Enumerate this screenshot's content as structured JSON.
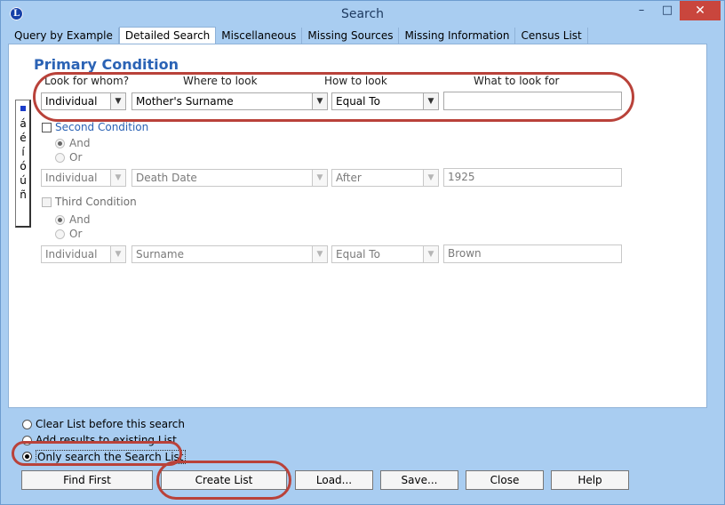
{
  "window": {
    "title": "Search",
    "app_icon_letter": "L",
    "min_glyph": "–",
    "max_glyph": "□",
    "close_glyph": "✕"
  },
  "tabs": [
    {
      "label": "Query by Example"
    },
    {
      "label": "Detailed Search"
    },
    {
      "label": "Miscellaneous"
    },
    {
      "label": "Missing Sources"
    },
    {
      "label": "Missing Information"
    },
    {
      "label": "Census List"
    }
  ],
  "primary": {
    "title": "Primary Condition",
    "headers": {
      "whom": "Look for whom?",
      "where": "Where to look",
      "how": "How to look",
      "what": "What to look for"
    },
    "whom": "Individual",
    "where": "Mother's Surname",
    "how": "Equal To",
    "what": ""
  },
  "second": {
    "label": "Second Condition",
    "and_label": "And",
    "or_label": "Or",
    "whom": "Individual",
    "where": "Death Date",
    "how": "After",
    "what": "1925"
  },
  "third": {
    "label": "Third Condition",
    "and_label": "And",
    "or_label": "Or",
    "whom": "Individual",
    "where": "Surname",
    "how": "Equal To",
    "what": "Brown"
  },
  "charstrip": [
    "á",
    "é",
    "í",
    "ó",
    "ú",
    "ñ"
  ],
  "options": {
    "clear": "Clear List before this search",
    "add": "Add results to existing List",
    "only": "Only search the Search List"
  },
  "buttons": {
    "find_first": "Find First",
    "create_list": "Create List",
    "load": "Load...",
    "save": "Save...",
    "close": "Close",
    "help": "Help"
  },
  "colors": {
    "accent": "#2b63b5",
    "annotation": "#b9423a",
    "frame": "#a9cdf1"
  }
}
